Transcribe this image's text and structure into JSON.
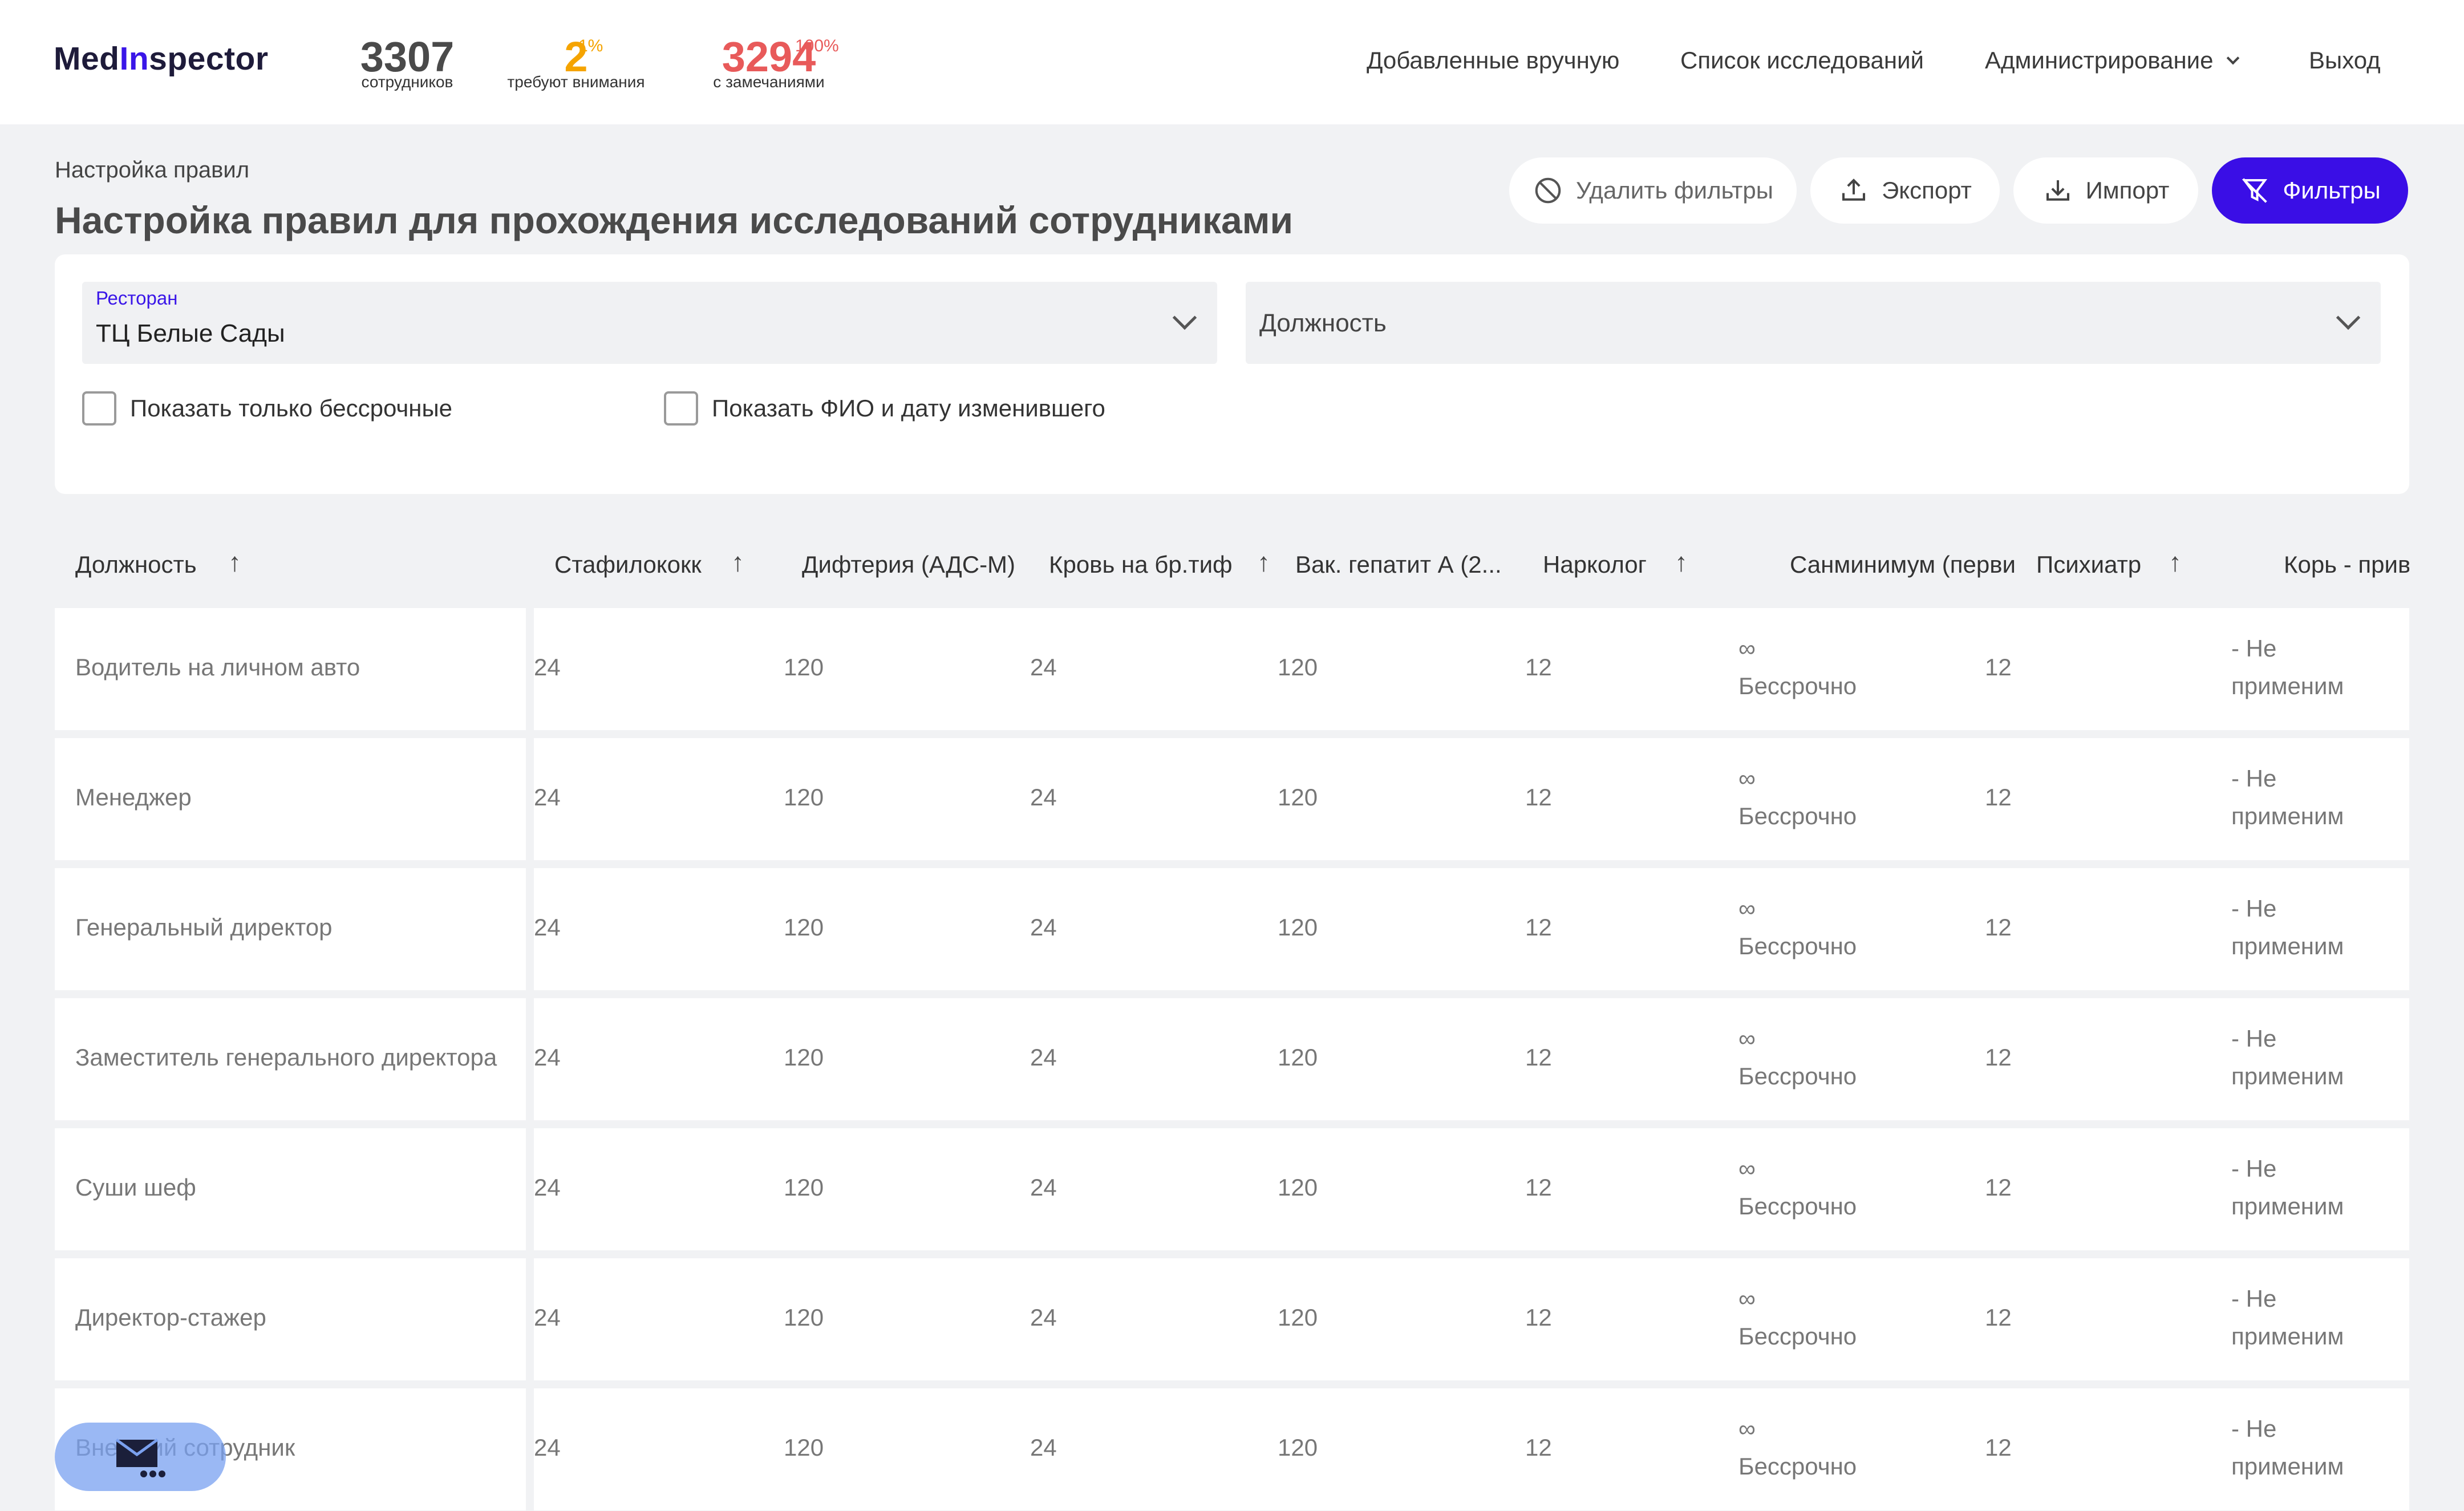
{
  "brand": {
    "part1": "Med",
    "part2": "In",
    "part3": "spector"
  },
  "stats": [
    {
      "value": "3307",
      "sup": "",
      "label": "сотрудников"
    },
    {
      "value": "2",
      "sup": "1%",
      "label": "требуют внимания"
    },
    {
      "value": "3294",
      "sup": "100%",
      "label": "с замечаниями"
    }
  ],
  "nav": {
    "manual": "Добавленные вручную",
    "list": "Список исследований",
    "admin": "Администрирование",
    "logout": "Выход"
  },
  "page": {
    "breadcrumb": "Настройка правил",
    "title": "Настройка правил для прохождения исследований сотрудниками"
  },
  "actions": {
    "clear": "Удалить фильтры",
    "export": "Экспорт",
    "import": "Импорт",
    "filters": "Фильтры"
  },
  "filters": {
    "restaurant_label": "Ресторан",
    "restaurant_value": "ТЦ Белые Сады",
    "position_placeholder": "Должность",
    "only_unlimited": "Показать только бессрочные",
    "show_editor": "Показать ФИО и дату изменившего"
  },
  "table": {
    "columns": [
      "Должность",
      "Стафилококк",
      "Дифтерия (АДС-М)",
      "Кровь на бр.тиф",
      "Вак. гепатит А (2...",
      "Нарколог",
      "Санминимум (перви",
      "Психиатр",
      "Корь - прив"
    ],
    "unlimited_symbol": "∞",
    "unlimited_text": "Бессрочно",
    "na_line1": "- Не",
    "na_line2": "применим",
    "rows": [
      {
        "name": "Водитель на личном авто",
        "v1": "24",
        "v2": "120",
        "v3": "24",
        "v4": "120",
        "v5": "12",
        "v7": "12"
      },
      {
        "name": "Менеджер",
        "v1": "24",
        "v2": "120",
        "v3": "24",
        "v4": "120",
        "v5": "12",
        "v7": "12"
      },
      {
        "name": "Генеральный директор",
        "v1": "24",
        "v2": "120",
        "v3": "24",
        "v4": "120",
        "v5": "12",
        "v7": "12"
      },
      {
        "name": "Заместитель генерального директора",
        "v1": "24",
        "v2": "120",
        "v3": "24",
        "v4": "120",
        "v5": "12",
        "v7": "12"
      },
      {
        "name": "Суши шеф",
        "v1": "24",
        "v2": "120",
        "v3": "24",
        "v4": "120",
        "v5": "12",
        "v7": "12"
      },
      {
        "name": "Директор-стажер",
        "v1": "24",
        "v2": "120",
        "v3": "24",
        "v4": "120",
        "v5": "12",
        "v7": "12"
      },
      {
        "name": "Внешний сотрудник",
        "v1": "24",
        "v2": "120",
        "v3": "24",
        "v4": "120",
        "v5": "12",
        "v7": "12"
      }
    ]
  },
  "colors": {
    "accent": "#3a0ee6",
    "warning": "#f5a400",
    "danger": "#e85a5a"
  }
}
